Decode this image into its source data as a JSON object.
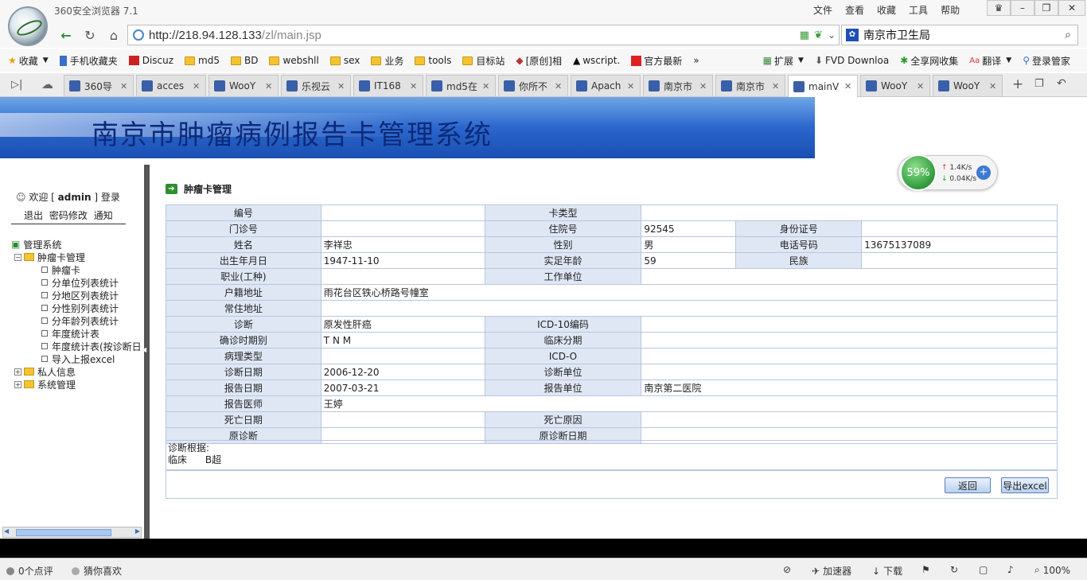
{
  "browser": {
    "app_title": "360安全浏览器 7.1",
    "menu": [
      "文件",
      "查看",
      "收藏",
      "工具",
      "帮助"
    ],
    "url_host": "http://218.94.128.133",
    "url_path": "/zl/main.jsp",
    "search_value": "南京市卫生局",
    "bookmarks": [
      "收藏",
      "手机收藏夹",
      "Discuz",
      "md5",
      "BD",
      "webshll",
      "sex",
      "业务",
      "tools",
      "目标站",
      "[原创]相",
      "wscript.",
      "官方最新"
    ],
    "toolbar_right": [
      "扩展",
      "FVD Downloa",
      "全享网收集",
      "翻译",
      "登录管家"
    ],
    "tabs": [
      "360导",
      "acces",
      "WooY",
      "乐视云",
      "IT168",
      "md5在",
      "你所不",
      "Apach",
      "南京市",
      "南京市",
      "mainV",
      "WooY",
      "WooY"
    ],
    "active_tab": 10
  },
  "banner": {
    "title": "南京市肿瘤病例报告卡管理系统"
  },
  "speed_widget": {
    "percent": "59%",
    "up": "1.4K/s",
    "down": "0.04K/s"
  },
  "sidebar": {
    "welcome_pre": "欢迎 [",
    "user": "admin",
    "welcome_post": "] 登录",
    "links": [
      "退出",
      "密码修改",
      "通知"
    ],
    "tree": {
      "root": "管理系统",
      "group1": "肿瘤卡管理",
      "items": [
        "肿瘤卡",
        "分单位列表统计",
        "分地区列表统计",
        "分性别列表统计",
        "分年龄列表统计",
        "年度统计表",
        "年度统计表(按诊断日",
        "导入上报excel"
      ],
      "group2": "私人信息",
      "group3": "系统管理"
    }
  },
  "main": {
    "section_title": "肿瘤卡管理",
    "labels": {
      "id": "编号",
      "card_type": "卡类型",
      "clinic_no": "门诊号",
      "inpatient_no": "住院号",
      "id_card": "身份证号",
      "name": "姓名",
      "sex": "性别",
      "phone": "电话号码",
      "birth": "出生年月日",
      "age": "实足年龄",
      "ethnicity": "民族",
      "job": "职业(工种)",
      "workplace": "工作单位",
      "domicile": "户籍地址",
      "residence": "常住地址",
      "diagnosis": "诊断",
      "icd10": "ICD-10编码",
      "stage_time": "确诊时期别",
      "clinical_stage": "临床分期",
      "pathology": "病理类型",
      "icdo": "ICD-O",
      "diag_date": "诊断日期",
      "diag_unit": "诊断单位",
      "report_date": "报告日期",
      "report_unit": "报告单位",
      "doctor": "报告医师",
      "death_date": "死亡日期",
      "death_cause": "死亡原因",
      "orig_diag": "原诊断",
      "orig_diag_date": "原诊断日期"
    },
    "values": {
      "inpatient_no": "92545",
      "name": "李祥忠",
      "sex": "男",
      "phone": "13675137089",
      "birth": "1947-11-10",
      "age": "59",
      "domicile": "雨花台区铁心桥路号幢室",
      "diagnosis": "原发性肝癌",
      "stage_time": "T N M",
      "diag_date": "2006-12-20",
      "report_date": "2007-03-21",
      "report_unit": "南京第二医院",
      "doctor": "王婷"
    },
    "basis_label": "诊断根据:",
    "basis_value": "临床      B超",
    "btn_back": "返回",
    "btn_export": "导出excel"
  },
  "statusbar": {
    "comments": "0个点评",
    "guess": "猜你喜欢",
    "accelerator": "加速器",
    "download": "下载",
    "zoom": "100%"
  }
}
